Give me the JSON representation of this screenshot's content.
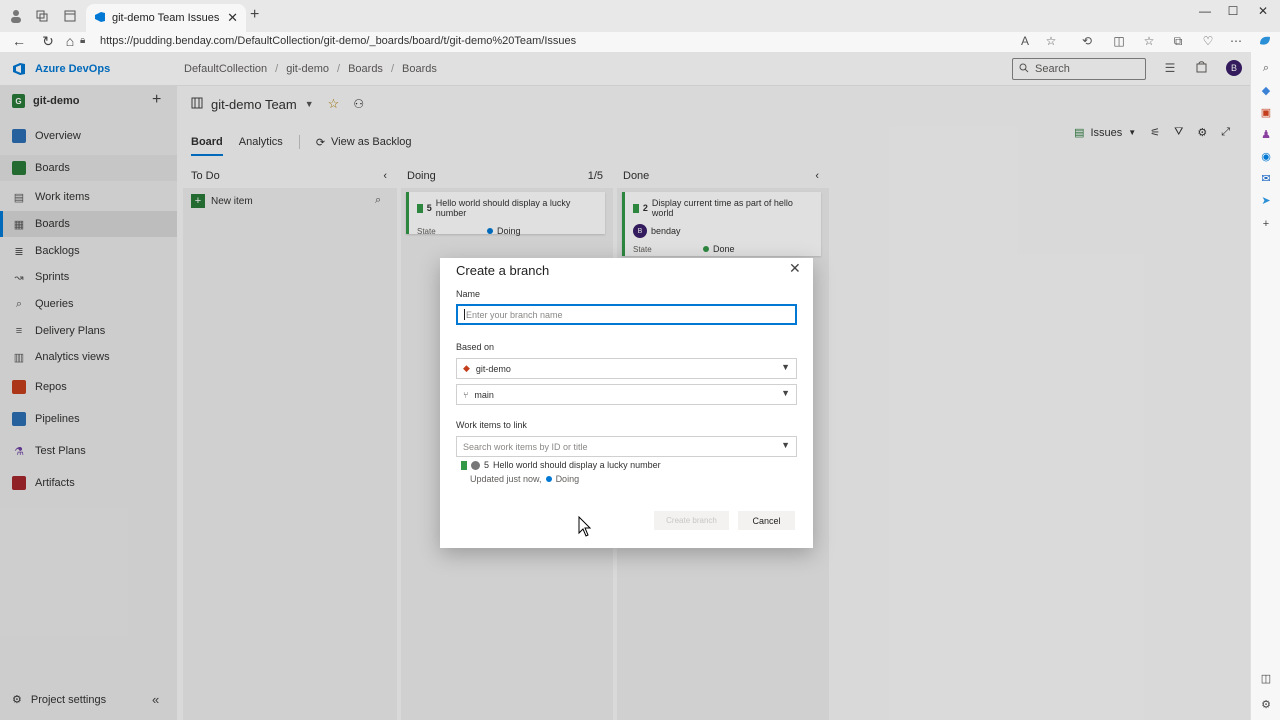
{
  "browser": {
    "tab_title": "git-demo Team Issues Board - Bo",
    "tab_close": "✕",
    "url": "https://pudding.benday.com/DefaultCollection/git-demo/_boards/board/t/git-demo%20Team/Issues"
  },
  "topnav": {
    "brand": "Azure DevOps",
    "breadcrumbs": [
      "DefaultCollection",
      "git-demo",
      "Boards",
      "Boards"
    ],
    "separator": "/",
    "search_placeholder": "Search",
    "user_initial": "B"
  },
  "leftnav": {
    "project_initial": "G",
    "project_name": "git-demo",
    "items": [
      {
        "label": "Overview",
        "icon": "overview-icon"
      },
      {
        "label": "Boards",
        "icon": "boards-icon"
      },
      {
        "label": "Work items",
        "icon": "work-items-icon"
      },
      {
        "label": "Boards",
        "icon": "board-icon"
      },
      {
        "label": "Backlogs",
        "icon": "backlogs-icon"
      },
      {
        "label": "Sprints",
        "icon": "sprints-icon"
      },
      {
        "label": "Queries",
        "icon": "queries-icon"
      },
      {
        "label": "Delivery Plans",
        "icon": "delivery-plans-icon"
      },
      {
        "label": "Analytics views",
        "icon": "analytics-views-icon"
      },
      {
        "label": "Repos",
        "icon": "repos-icon"
      },
      {
        "label": "Pipelines",
        "icon": "pipelines-icon"
      },
      {
        "label": "Test Plans",
        "icon": "test-plans-icon"
      },
      {
        "label": "Artifacts",
        "icon": "artifacts-icon"
      }
    ],
    "project_settings": "Project settings"
  },
  "board": {
    "team": "git-demo Team",
    "tabs": [
      "Board",
      "Analytics"
    ],
    "view_as_backlog": "View as Backlog",
    "work_item_type": "Issues",
    "columns": [
      {
        "name": "To Do",
        "count": ""
      },
      {
        "name": "Doing",
        "count": "1/5"
      },
      {
        "name": "Done",
        "count": ""
      }
    ],
    "new_item": "New item",
    "cards": [
      {
        "id": "5",
        "title": "Hello world should display a lucky number",
        "state_label": "State",
        "state": "Doing",
        "state_color": "#0078d4"
      },
      {
        "id": "2",
        "title": "Display current time as part of hello world",
        "assignee": "benday",
        "assignee_initial": "B",
        "state_label": "State",
        "state": "Done",
        "state_color": "#339947"
      }
    ]
  },
  "dialog": {
    "title": "Create a branch",
    "name_label": "Name",
    "name_placeholder": "Enter your branch name",
    "based_on_label": "Based on",
    "repo": "git-demo",
    "branch": "main",
    "work_items_label": "Work items to link",
    "work_items_placeholder": "Search work items by ID or title",
    "linked_item": {
      "id": "5",
      "title": "Hello world should display a lucky number",
      "updated": "Updated just now,",
      "state": "Doing"
    },
    "create_button": "Create branch",
    "cancel_button": "Cancel"
  },
  "colors": {
    "accent": "#0078d4",
    "issue_green": "#339947"
  }
}
